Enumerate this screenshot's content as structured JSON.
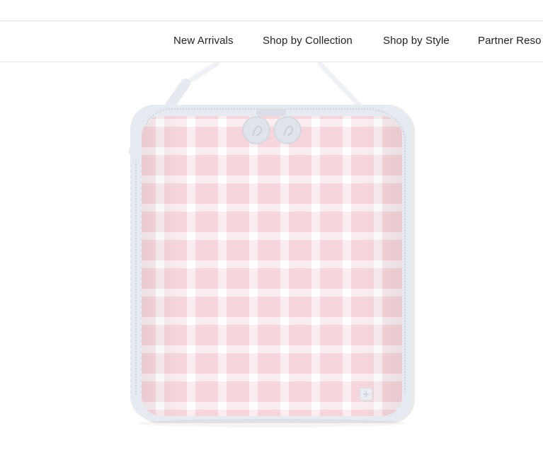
{
  "nav": {
    "items": [
      {
        "label": "New Arrivals"
      },
      {
        "label": "Shop by Collection"
      },
      {
        "label": "Shop by Style"
      },
      {
        "label": "Partner Reso"
      }
    ]
  },
  "product_image": {
    "icon": "lunch-bag-image",
    "colors": {
      "pink": "#f6d6dc",
      "check": "#fbf4f6",
      "trim": "#e4e8ef",
      "zipper_pull": "#dfe4ec"
    }
  }
}
